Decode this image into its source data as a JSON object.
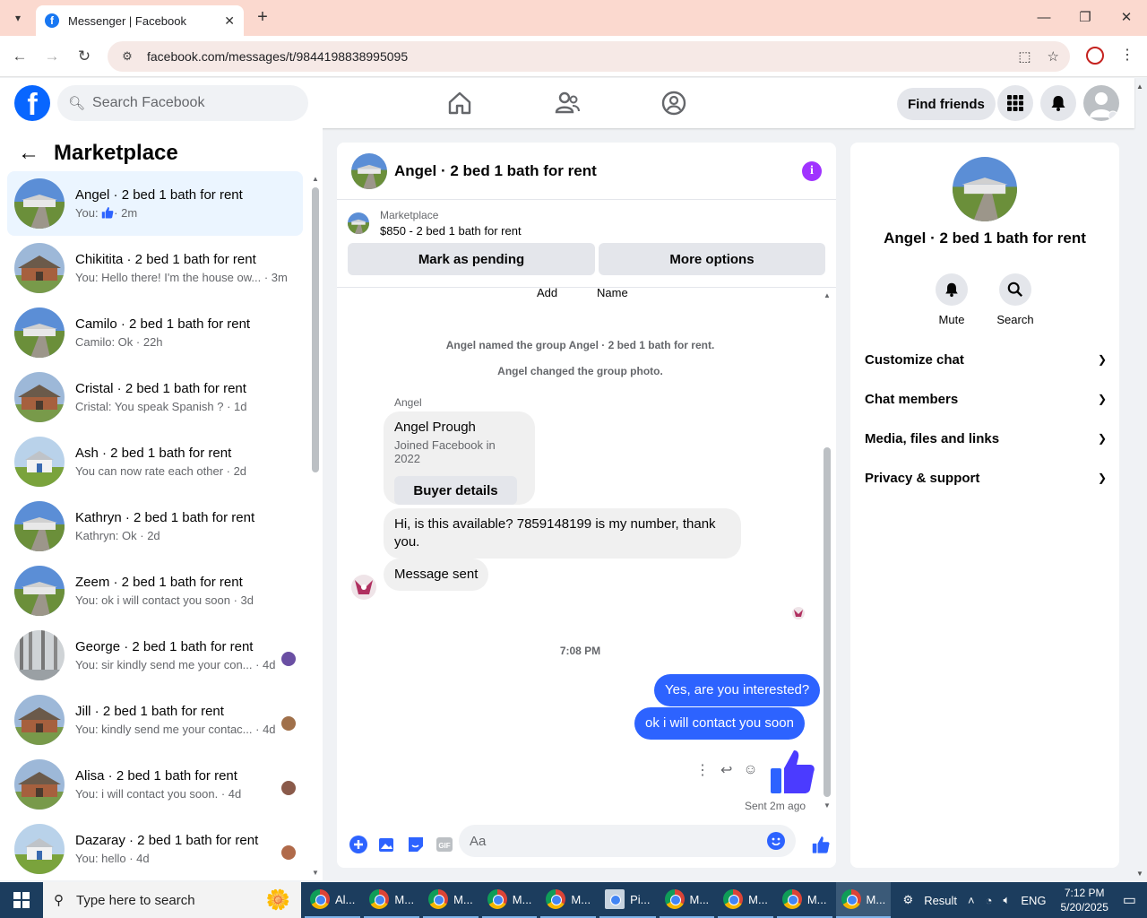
{
  "browser": {
    "tab_title": "Messenger | Facebook",
    "url": "facebook.com/messages/t/9844198838995095"
  },
  "fb": {
    "search_placeholder": "Search Facebook",
    "find_friends": "Find friends"
  },
  "left": {
    "title": "Marketplace",
    "conversations": [
      {
        "name": "Angel · 2 bed 1 bath for rent",
        "preview": "You: ",
        "time": "· 2m",
        "thumb": "house-a",
        "active": true
      },
      {
        "name": "Chikitita · 2 bed 1 bath for rent",
        "preview": "You: Hello there! I'm the house ow... · 3m",
        "thumb": "house-b"
      },
      {
        "name": "Camilo · 2 bed 1 bath for rent",
        "preview": "Camilo: Ok · 22h",
        "thumb": "house-a"
      },
      {
        "name": "Cristal · 2 bed 1 bath for rent",
        "preview": "Cristal: You speak Spanish ? · 1d",
        "thumb": "house-b"
      },
      {
        "name": "Ash · 2 bed 1 bath for rent",
        "preview": "You can now rate each other · 2d",
        "thumb": "house-c"
      },
      {
        "name": "Kathryn · 2 bed 1 bath for rent",
        "preview": "Kathryn: Ok · 2d",
        "thumb": "house-a"
      },
      {
        "name": "Zeem · 2 bed 1 bath for rent",
        "preview": "You: ok i will contact you soon · 3d",
        "thumb": "house-a"
      },
      {
        "name": "George · 2 bed 1 bath for rent",
        "preview": "You: sir kindly send me your con... · 4d",
        "thumb": "house-d"
      },
      {
        "name": "Jill · 2 bed 1 bath for rent",
        "preview": "You: kindly send me your contac... · 4d",
        "thumb": "house-b"
      },
      {
        "name": "Alisa · 2 bed 1 bath for rent",
        "preview": "You: i will contact you soon. · 4d",
        "thumb": "house-b"
      },
      {
        "name": "Dazaray · 2 bed 1 bath for rent",
        "preview": "You: hello · 4d",
        "thumb": "house-c"
      }
    ]
  },
  "chat": {
    "title": "Angel · 2 bed 1 bath for rent",
    "listing_label": "Marketplace",
    "listing_price": "$850 - 2 bed 1 bath for rent",
    "mark_pending": "Mark as pending",
    "more_options": "More options",
    "col_add": "Add",
    "col_name": "Name",
    "sys_1": "Angel named the group Angel · 2 bed 1 bath for rent.",
    "sys_2": "Angel changed the group photo.",
    "sender": "Angel",
    "profile_name": "Angel Prough",
    "profile_joined": "Joined Facebook in 2022",
    "buyer_details": "Buyer details",
    "msg_1": "Hi, is this available? 7859148199 is my number, thank you.",
    "msg_2": "Message sent",
    "timestamp": "7:08 PM",
    "out_1": "Yes, are you interested?",
    "out_2": "ok i  will contact  you soon",
    "sent_status": "Sent 2m ago",
    "composer_placeholder": "Aa"
  },
  "info": {
    "title": "Angel · 2 bed 1 bath for rent",
    "mute": "Mute",
    "search": "Search",
    "sections": [
      "Customize chat",
      "Chat members",
      "Media, files and links",
      "Privacy & support"
    ]
  },
  "taskbar": {
    "search_text": "Type here to search",
    "apps": [
      "Al...",
      "M...",
      "M...",
      "M...",
      "M...",
      "Pi...",
      "M...",
      "M...",
      "M...",
      "M..."
    ],
    "result": "Result",
    "lang": "ENG",
    "time": "7:12 PM",
    "date": "5/20/2025"
  },
  "colors": {
    "fb_blue": "#0866ff",
    "bubble_out": "#2d63ff",
    "active_conv": "#ebf5ff",
    "info_purple": "#a033ff"
  }
}
